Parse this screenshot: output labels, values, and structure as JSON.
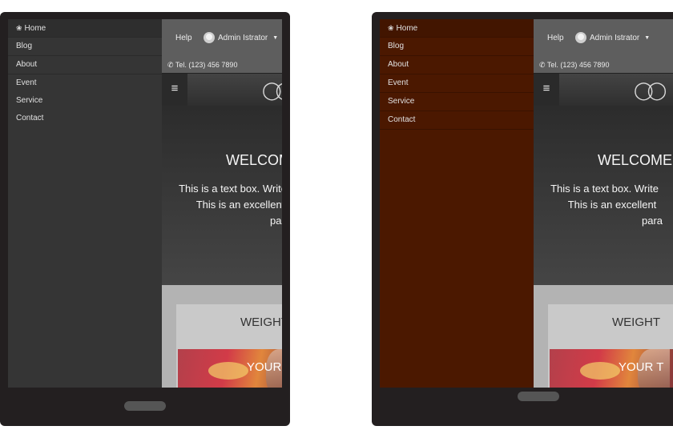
{
  "nav": {
    "items": [
      {
        "label": "Home"
      },
      {
        "label": "Blog"
      },
      {
        "label": "About"
      },
      {
        "label": "Event"
      },
      {
        "label": "Service"
      },
      {
        "label": "Contact"
      }
    ]
  },
  "topbar": {
    "help": "Help",
    "user": "Admin Istrator",
    "phone": "Tel. (123) 456 7890"
  },
  "hero": {
    "title": "WELCOME TO",
    "line1": "This is a text box. Write",
    "line2": "This is an excellent",
    "line3": "para"
  },
  "section": {
    "title": "WEIGHT",
    "photo_caption": "YOUR T"
  },
  "colors": {
    "sidebar_dark": "#353535",
    "sidebar_brown": "#4b1800",
    "device_frame": "#231f20"
  },
  "icons": {
    "home": "house-icon",
    "user": "user-avatar-icon",
    "phone": "phone-icon",
    "menu": "hamburger-menu-icon",
    "logo": "infinity-logo"
  }
}
